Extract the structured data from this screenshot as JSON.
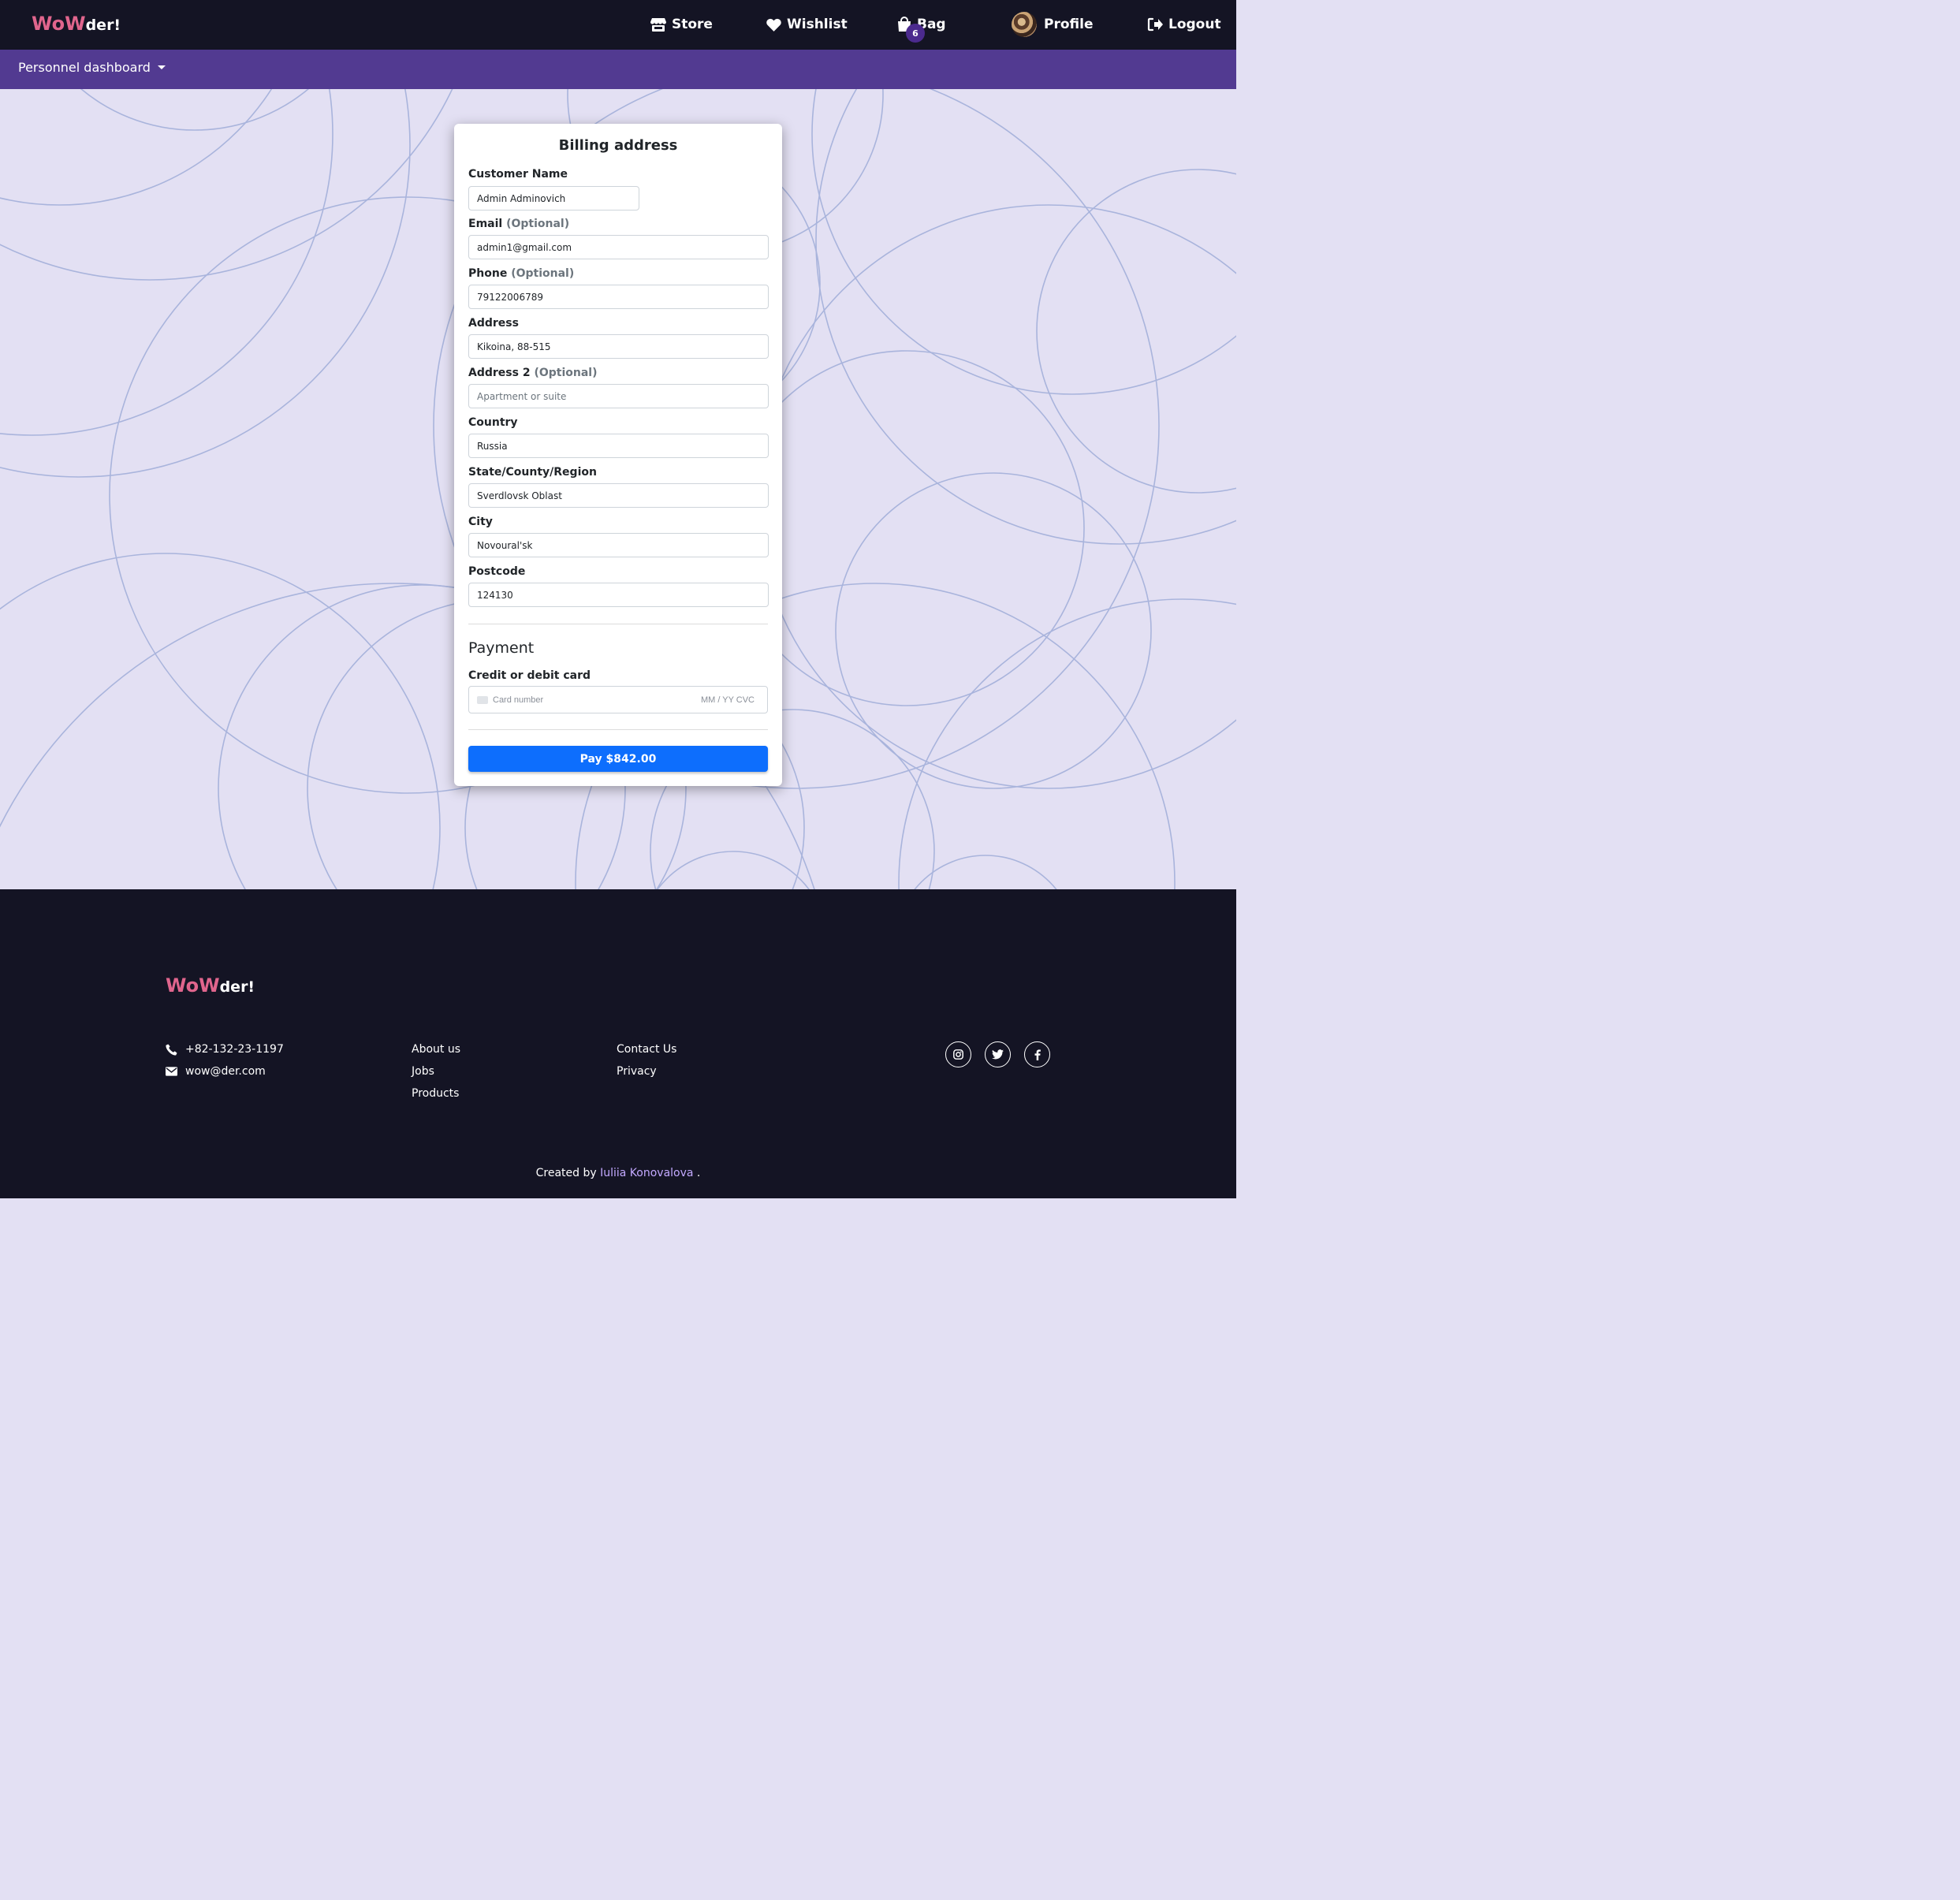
{
  "brand": {
    "part1": "WoW",
    "part2": "der!"
  },
  "nav": {
    "store": "Store",
    "wishlist": "Wishlist",
    "bag": "Bag",
    "bag_count": "6",
    "profile": "Profile",
    "logout": "Logout"
  },
  "subnav": {
    "dashboard": "Personnel dashboard"
  },
  "form": {
    "title": "Billing address",
    "customer_name": {
      "label": "Customer Name",
      "value": "Admin Adminovich"
    },
    "email": {
      "label": "Email",
      "optional": "(Optional)",
      "value": "admin1@gmail.com"
    },
    "phone": {
      "label": "Phone",
      "optional": "(Optional)",
      "value": "79122006789"
    },
    "address": {
      "label": "Address",
      "value": "Kikoina, 88-515"
    },
    "address2": {
      "label": "Address 2",
      "optional": "(Optional)",
      "placeholder": "Apartment or suite"
    },
    "country": {
      "label": "Country",
      "value": "Russia"
    },
    "state": {
      "label": "State/County/Region",
      "value": "Sverdlovsk Oblast"
    },
    "city": {
      "label": "City",
      "value": "Novoural'sk"
    },
    "postcode": {
      "label": "Postcode",
      "value": "124130"
    }
  },
  "payment": {
    "title": "Payment",
    "card_label": "Credit or debit card",
    "card_number_placeholder": "Card number",
    "expiry_cvc_placeholder": "MM / YY  CVC",
    "pay_button": "Pay $842.00"
  },
  "footer": {
    "phone": "+82-132-23-1197",
    "email": "wow@der.com",
    "links_col1": [
      "About us",
      "Jobs",
      "Products"
    ],
    "links_col2": [
      "Contact Us",
      "Privacy"
    ],
    "credit_prefix": "Created by",
    "credit_author": "Iuliia Konovalova",
    "credit_suffix": "."
  },
  "colors": {
    "nav_bg": "#141424",
    "subnav_bg": "#523a91",
    "page_bg": "#e3e0f3",
    "brand_pink": "#e0658d",
    "pay_button": "#0d6efd",
    "circle_stroke": "#a9b4dc"
  }
}
